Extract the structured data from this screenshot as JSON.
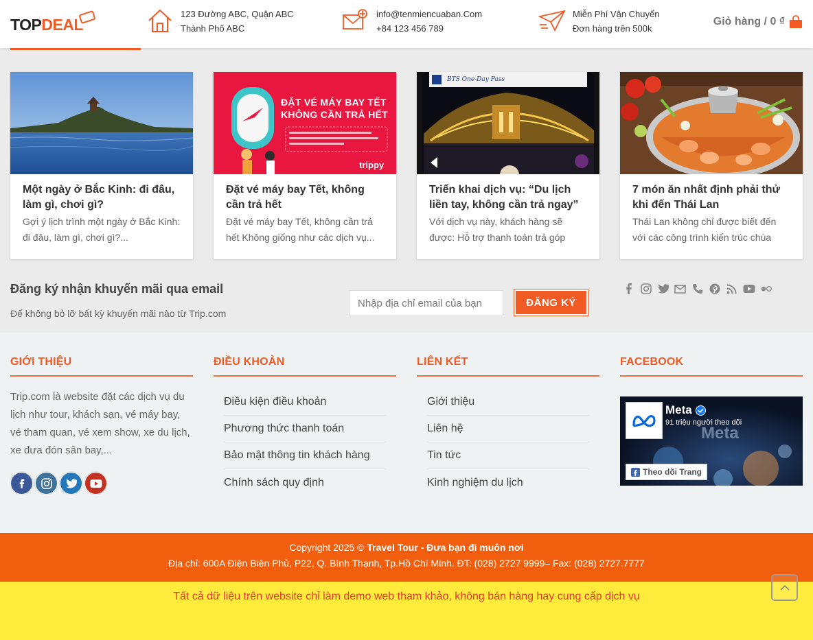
{
  "header": {
    "logo_part1": "TOP",
    "logo_part2": "DEAL",
    "address_line1": "123 Đường ABC, Quận ABC",
    "address_line2": "Thành Phố ABC",
    "email": "info@tenmiencuaban.Com",
    "phone": "+84 123 456 789",
    "shipping_line1": "Miễn Phí Vận Chuyển",
    "shipping_line2": "Đơn hàng trên 500k",
    "cart_label": "Giỏ hàng / 0 ₫",
    "accent_color": "#f15a22"
  },
  "posts": [
    {
      "title": "Một ngày ở Bắc Kinh: đi đâu, làm gì, chơi gì?",
      "excerpt": "Gợi ý lịch trình một ngày ở Bắc Kinh: đi đâu, làm gì, chơi gì?..."
    },
    {
      "title": "Đặt vé máy bay Tết, không cần trả hết",
      "excerpt": "Đặt vé máy bay Tết, không cần trả hết Không giống như các dịch vụ...",
      "banner_line1": "ĐẶT VÉ MÁY BAY TẾT",
      "banner_line2": "KHÔNG CẦN TRẢ HẾT",
      "brand": "trippy"
    },
    {
      "title": "Triển khai dịch vụ: “Du lịch liền tay, không cần trả ngay”",
      "excerpt": "Với dịch vụ này, khách hàng sẽ được: Hỗ trợ thanh toán trả góp",
      "card_caption": "BTS One-Day Pass"
    },
    {
      "title": "7 món ăn nhất định phải thử khi đến Thái Lan",
      "excerpt": "Thái Lan không chỉ được biết đến với các công trình kiến trúc chùa"
    }
  ],
  "newsletter": {
    "title": "Đăng ký nhận khuyến mãi qua email",
    "subtitle": "Để không bỏ lỡ bất kỳ khuyến mãi nào từ Trip.com",
    "placeholder": "Nhập địa chỉ email của bạn",
    "button": "ĐĂNG KÝ"
  },
  "footer": {
    "about_title": "GIỚI THIỆU",
    "about_text": "Trip.com là website đặt các dịch vụ du lịch như tour, khách sạn, vé máy bay, vé tham quan, vé xem show, xe du lịch, xe đưa đón sân bay,...",
    "terms_title": "ĐIỀU KHOẢN",
    "terms_links": [
      "Điều kiện điều khoản",
      "Phương thức thanh toán",
      "Bảo mật thông tin khách hàng",
      "Chính sách quy định"
    ],
    "links_title": "LIÊN KẾT",
    "links": [
      "Giới thiệu",
      "Liên hệ",
      "Tin tức",
      "Kinh nghiệm du lịch"
    ],
    "facebook_title": "FACEBOOK",
    "fb_page_name": "Meta",
    "fb_followers": "91 triệu người theo dõi",
    "fb_follow_button": "Theo dõi Trang",
    "fb_cover_text": "Meta"
  },
  "copyright": {
    "prefix": "Copyright 2025 © ",
    "brand": "Travel Tour - Đưa bạn đi muôn nơi",
    "address": "Địa chỉ: 600A Điện Biên Phủ, P22, Q. Bình Thạnh, Tp.Hồ Chí Minh. ĐT: (028) 2727 9999– Fax: (028) 2727.7777"
  },
  "demo_notice": "Tất cả dữ liệu trên website chỉ làm demo web tham khảo, không bán hàng hay cung cấp dịch vụ",
  "colors": {
    "orange": "#f15f0e",
    "yellow": "#ffeb3b",
    "notice_red": "#e53935",
    "facebook": "#3b5998",
    "instagram": "#3f729b",
    "twitter": "#2478ba",
    "youtube": "#c33223"
  }
}
